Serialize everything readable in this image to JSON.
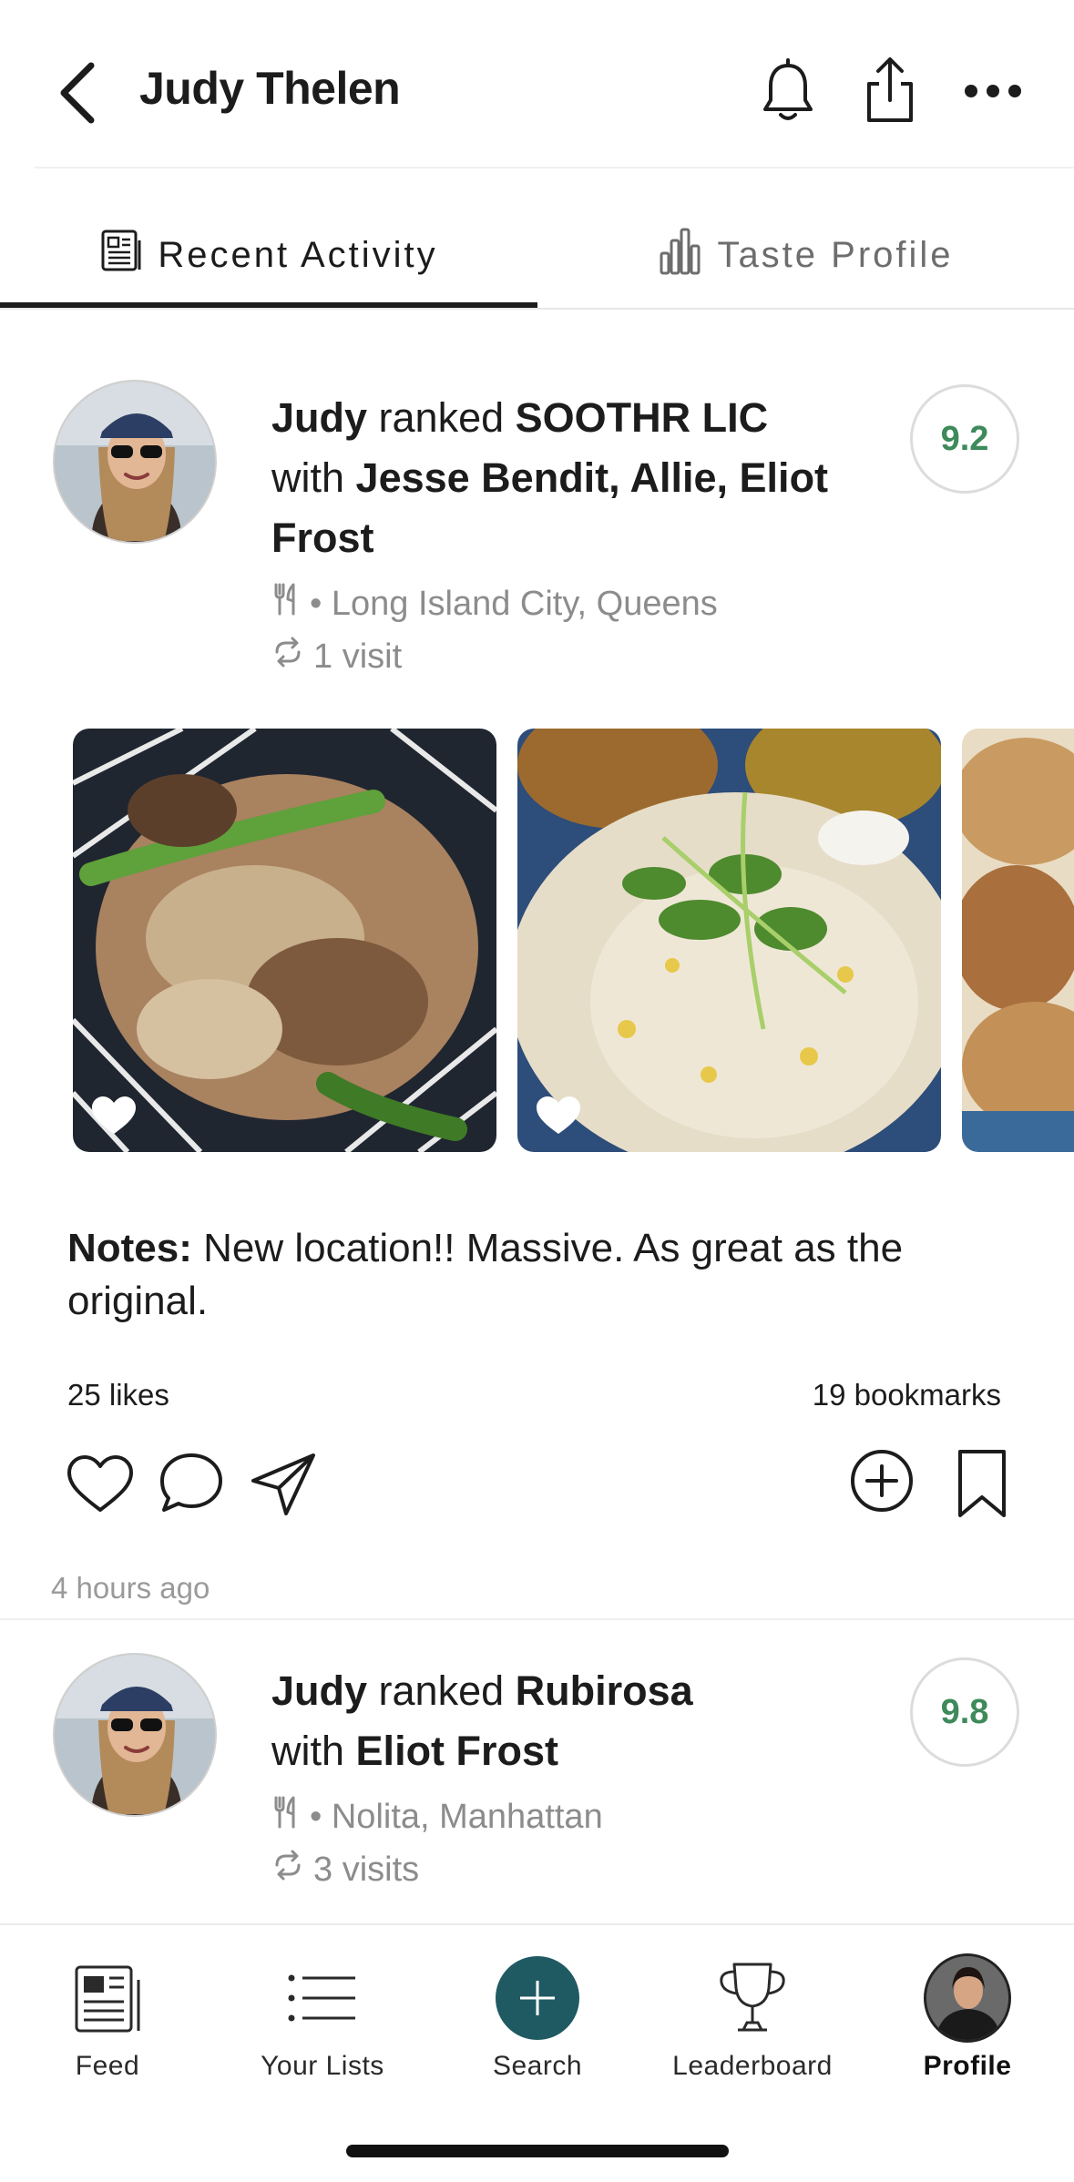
{
  "header": {
    "title": "Judy Thelen",
    "icons": [
      "back-icon",
      "bell-icon",
      "share-icon",
      "more-icon"
    ]
  },
  "tabs": [
    {
      "label": "Recent Activity",
      "icon": "document-icon",
      "active": true
    },
    {
      "label": "Taste Profile",
      "icon": "bar-chart-icon",
      "active": false
    }
  ],
  "posts": [
    {
      "user": "Judy",
      "verb": "ranked",
      "place": "SOOTHR LIC",
      "with_word": "with",
      "companions": "Jesse Bendit, Allie, Eliot Frost",
      "location": "• Long Island City, Queens",
      "visits": "1 visit",
      "score": "9.2",
      "notes_label": "Notes:",
      "notes": "New location!! Massive. As great as the original.",
      "likes": "25 likes",
      "bookmarks": "19 bookmarks",
      "time": "4 hours ago"
    },
    {
      "user": "Judy",
      "verb": "ranked",
      "place": "Rubirosa",
      "with_word": "with",
      "companions": "Eliot Frost",
      "location": "• Nolita, Manhattan",
      "visits": "3 visits",
      "score": "9.8"
    }
  ],
  "nav": [
    {
      "label": "Feed",
      "icon": "feed-icon"
    },
    {
      "label": "Your Lists",
      "icon": "list-icon"
    },
    {
      "label": "Search",
      "icon": "plus-icon"
    },
    {
      "label": "Leaderboard",
      "icon": "trophy-icon"
    },
    {
      "label": "Profile",
      "icon": "avatar",
      "active": true
    }
  ],
  "colors": {
    "score_green": "#3e8a5a",
    "search_teal": "#1f5a63",
    "muted_gray": "#8c8c8c"
  }
}
